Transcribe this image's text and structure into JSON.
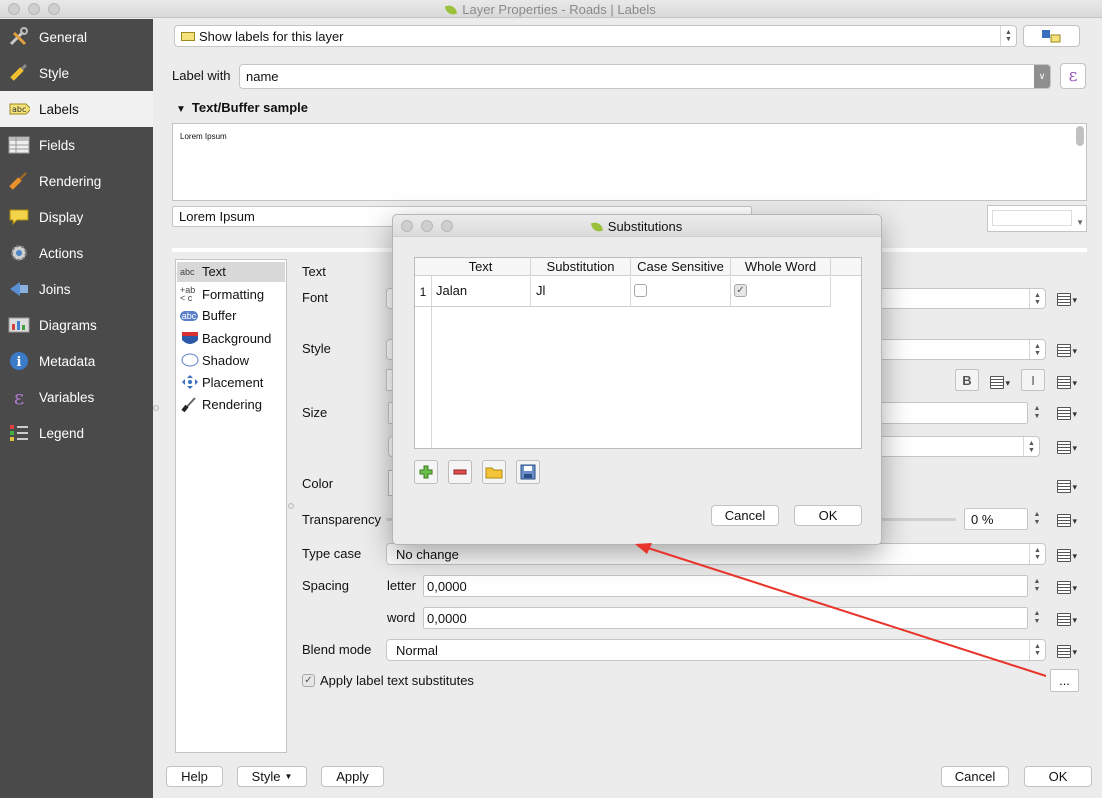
{
  "window": {
    "title": "Layer Properties - Roads | Labels"
  },
  "sidebar": {
    "items": [
      {
        "label": "General",
        "icon": "tools-icon"
      },
      {
        "label": "Style",
        "icon": "paintbrush-icon"
      },
      {
        "label": "Labels",
        "icon": "abc-label-icon"
      },
      {
        "label": "Fields",
        "icon": "table-icon"
      },
      {
        "label": "Rendering",
        "icon": "brush-icon"
      },
      {
        "label": "Display",
        "icon": "speech-bubble-icon"
      },
      {
        "label": "Actions",
        "icon": "gear-icon"
      },
      {
        "label": "Joins",
        "icon": "join-icon"
      },
      {
        "label": "Diagrams",
        "icon": "diagram-icon"
      },
      {
        "label": "Metadata",
        "icon": "info-icon"
      },
      {
        "label": "Variables",
        "icon": "epsilon-icon"
      },
      {
        "label": "Legend",
        "icon": "legend-icon"
      }
    ],
    "active_index": 2
  },
  "top": {
    "mode": "Show labels for this layer",
    "label_with_text": "Label with",
    "label_with_value": "name",
    "expression_symbol": "ε",
    "sample_header": "Text/Buffer sample",
    "sample_text": "Lorem Ipsum",
    "sample_input": "Lorem Ipsum"
  },
  "subtabs": [
    {
      "label": "Text",
      "icon": "abc-icon"
    },
    {
      "label": "Formatting",
      "icon": "formatting-icon"
    },
    {
      "label": "Buffer",
      "icon": "buffer-icon"
    },
    {
      "label": "Background",
      "icon": "background-icon"
    },
    {
      "label": "Shadow",
      "icon": "shadow-icon"
    },
    {
      "label": "Placement",
      "icon": "placement-icon"
    },
    {
      "label": "Rendering",
      "icon": "rendering-icon"
    }
  ],
  "text_panel": {
    "header": "Text",
    "font_label": "Font",
    "style_label": "Style",
    "size_label": "Size",
    "color_label": "Color",
    "transparency_label": "Transparency",
    "transparency_value": "0 %",
    "type_case_label": "Type case",
    "type_case_value": "No change",
    "spacing_label": "Spacing",
    "letter_label": "letter",
    "letter_value": "0,0000",
    "word_label": "word",
    "word_value": "0,0000",
    "blend_label": "Blend mode",
    "blend_value": "Normal",
    "bold_label": "B",
    "italic_label": "I",
    "apply_substitutes_label": "Apply label text substitutes",
    "ellipsis_label": "..."
  },
  "bottom": {
    "help": "Help",
    "style": "Style",
    "apply": "Apply",
    "cancel": "Cancel",
    "ok": "OK"
  },
  "substitutions_dialog": {
    "title": "Substitutions",
    "columns": [
      "Text",
      "Substitution",
      "Case Sensitive",
      "Whole Word"
    ],
    "rows": [
      {
        "num": "1",
        "text": "Jalan",
        "substitution": "Jl",
        "case_sensitive": false,
        "whole_word": true
      }
    ],
    "cancel": "Cancel",
    "ok": "OK"
  },
  "colors": {
    "sidebar_bg": "#4a4a4a",
    "arrow": "#e8342a"
  }
}
